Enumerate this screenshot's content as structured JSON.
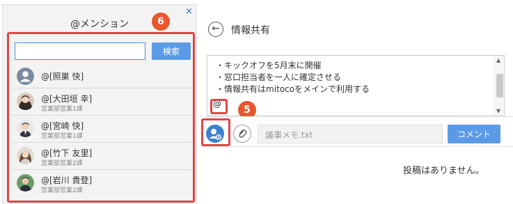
{
  "mention_panel": {
    "title": "@メンション",
    "close": "×",
    "search_placeholder": "",
    "search_button": "検索",
    "badge": "6",
    "users": [
      {
        "name": "@[照巣 快]",
        "dept": ""
      },
      {
        "name": "@[大田垣 幸]",
        "dept": "営業部営業1課"
      },
      {
        "name": "@[宮崎 快]",
        "dept": "営業部営業1課"
      },
      {
        "name": "@[竹下 友里]",
        "dept": "営業部営業2課"
      },
      {
        "name": "@[岩川 貴登]",
        "dept": "営業部営業2課"
      }
    ]
  },
  "feed": {
    "back": "←",
    "title": "情報共有",
    "editor_lines": [
      "・キックオフを5月末に開催",
      "・窓口担当者を一人に確定させる",
      "・情報共有はmitocoをメインで利用する"
    ],
    "editor_mention": "@",
    "badge": "5",
    "attachment": "議事メモ.txt",
    "comment_button": "コメント",
    "empty_message": "投稿はありません。"
  },
  "colors": {
    "accent": "#5b9be6",
    "highlight": "#e04646",
    "badge": "#e8572d"
  }
}
